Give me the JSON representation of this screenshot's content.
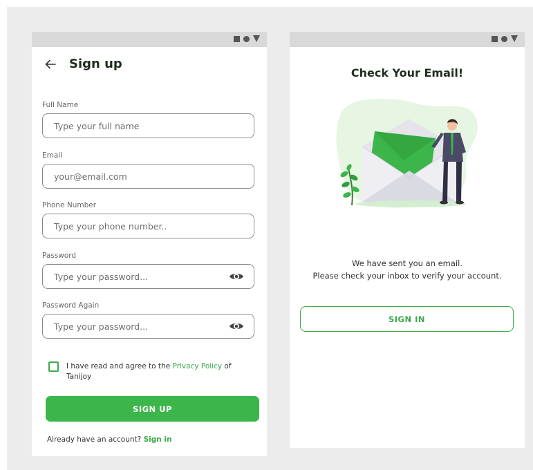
{
  "signup_screen": {
    "title": "Sign up",
    "fields": [
      {
        "label": "Full Name",
        "placeholder": "Type your full name",
        "value": ""
      },
      {
        "label": "Email",
        "placeholder": "your@email.com",
        "value": ""
      },
      {
        "label": "Phone Number",
        "placeholder": "Type your phone number..",
        "value": ""
      },
      {
        "label": "Password",
        "placeholder": "Type your password...",
        "value": ""
      },
      {
        "label": "Password Again",
        "placeholder": "Type your password...",
        "value": ""
      }
    ],
    "agree": {
      "prefix": "I have read and agree to the ",
      "link": "Privacy Policy",
      "suffix": " of Tanijoy",
      "checked": false
    },
    "signup_button": "SIGN UP",
    "already": {
      "text": "Already have an account? ",
      "link": "Sign in"
    }
  },
  "check_screen": {
    "title": "Check Your Email!",
    "message_line1": "We have sent you an email.",
    "message_line2": "Please check your inbox to verify your account.",
    "signin_button": "SIGN IN"
  },
  "colors": {
    "accent_green": "#3cb54a",
    "background": "#ececec",
    "status_bar": "#d9d9d9",
    "text_dark": "#1f2d1f"
  },
  "icons": {
    "back": "arrow-left-icon",
    "password_toggle": "eye-icon",
    "status": [
      "square-icon",
      "circle-icon",
      "triangle-down-icon"
    ]
  }
}
